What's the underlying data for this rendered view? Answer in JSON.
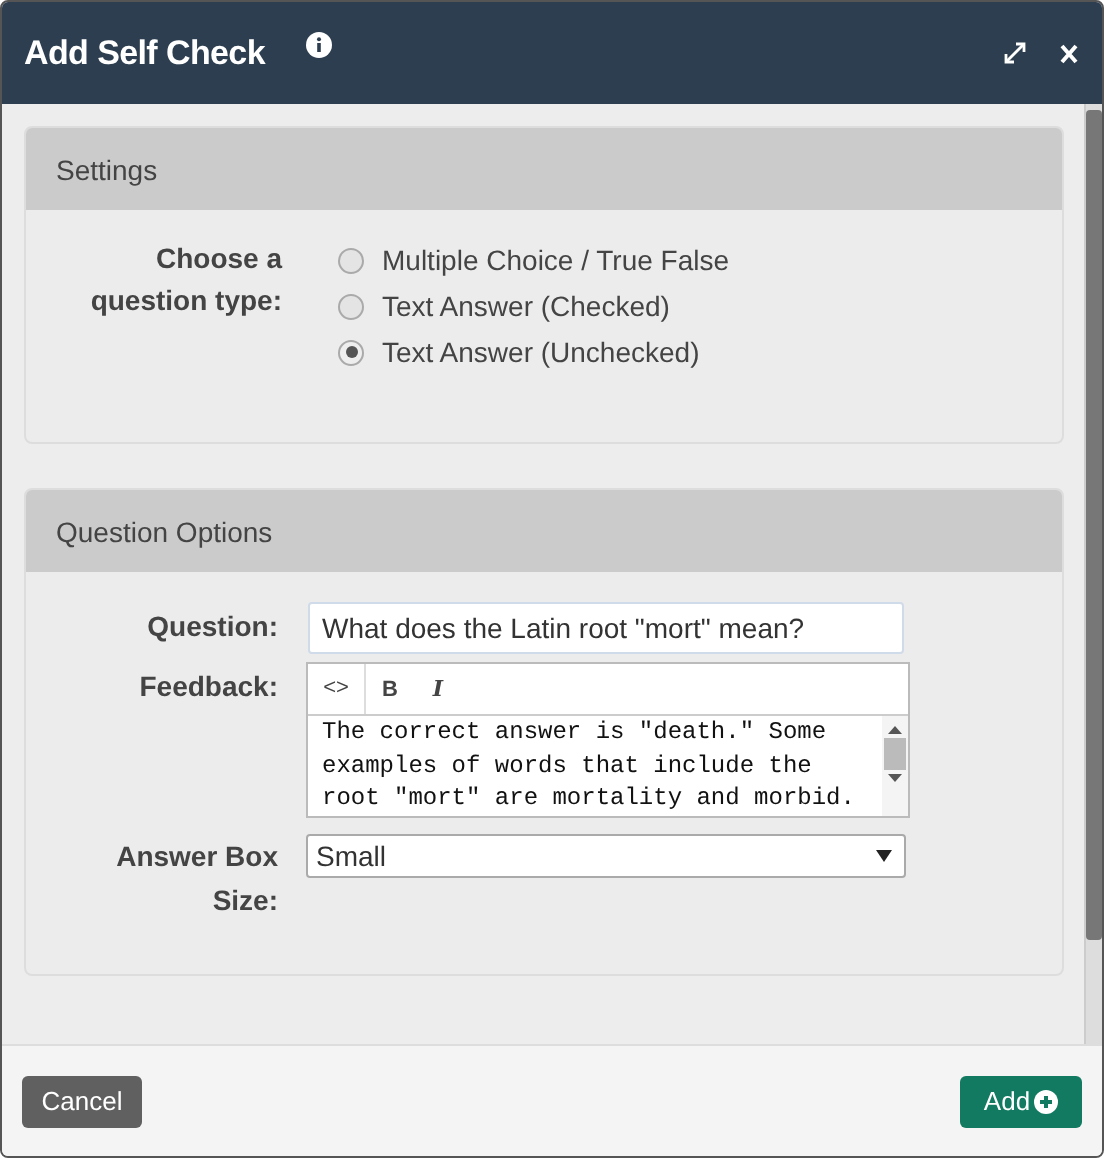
{
  "window": {
    "title": "Add Self Check"
  },
  "settings": {
    "heading": "Settings",
    "question_type_label": "Choose a question type:",
    "options": [
      {
        "label": "Multiple Choice / True False",
        "selected": false
      },
      {
        "label": "Text Answer (Checked)",
        "selected": false
      },
      {
        "label": "Text Answer (Unchecked)",
        "selected": true
      }
    ]
  },
  "question_options": {
    "heading": "Question Options",
    "question": {
      "label": "Question:",
      "value": "What does the Latin root \"mort\" mean?"
    },
    "feedback": {
      "label": "Feedback:",
      "toolbar": [
        "<>",
        "B",
        "I"
      ],
      "value": "The correct answer is \"death.\" Some examples of words that include the root \"mort\" are mortality and morbid."
    },
    "answer_box_size": {
      "label": "Answer Box Size:",
      "value": "Small"
    }
  },
  "buttons": {
    "cancel": "Cancel",
    "add": "Add"
  }
}
